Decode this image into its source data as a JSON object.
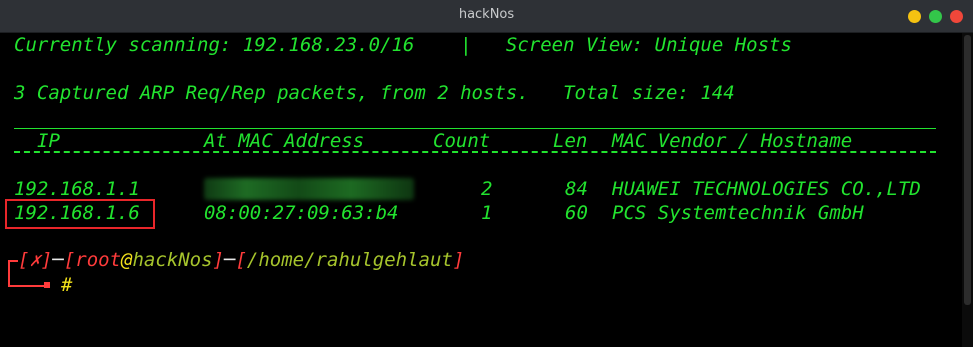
{
  "window": {
    "title": "hackNos",
    "controls": {
      "minimize": "#f5c211",
      "maximize": "#33c64a",
      "close": "#f0473a"
    }
  },
  "status": {
    "scanning": "Currently scanning: 192.168.23.0/16",
    "divider": "|",
    "screen_view": "Screen View: Unique Hosts",
    "captured": "3 Captured ARP Req/Rep packets, from 2 hosts.",
    "total_size": "Total size: 144"
  },
  "table": {
    "headers": {
      "ip": "IP",
      "mac": "At MAC Address",
      "count": "Count",
      "len": "Len",
      "vendor": "MAC Vendor / Hostname"
    },
    "rows": [
      {
        "ip": "192.168.1.1",
        "mac": "",
        "count": "2",
        "len": "84",
        "vendor": "HUAWEI TECHNOLOGIES CO.,LTD"
      },
      {
        "ip": "192.168.1.6",
        "mac": "08:00:27:09:63:b4",
        "count": "1",
        "len": "60",
        "vendor": "PCS Systemtechnik GmbH"
      }
    ]
  },
  "prompt": {
    "open_bracket": "[",
    "status_symbol": "✗",
    "close_bracket": "]",
    "user": "root",
    "at": "@",
    "host": "hackNos",
    "path": "/home/rahulgehlaut",
    "symbol": "#"
  },
  "colors": {
    "terminal_fg": "#22e32f",
    "prompt_red": "#ff3b3b",
    "prompt_yellow": "#f3e21a",
    "path_olive": "#a6c42c",
    "highlight": "#e8262a"
  }
}
